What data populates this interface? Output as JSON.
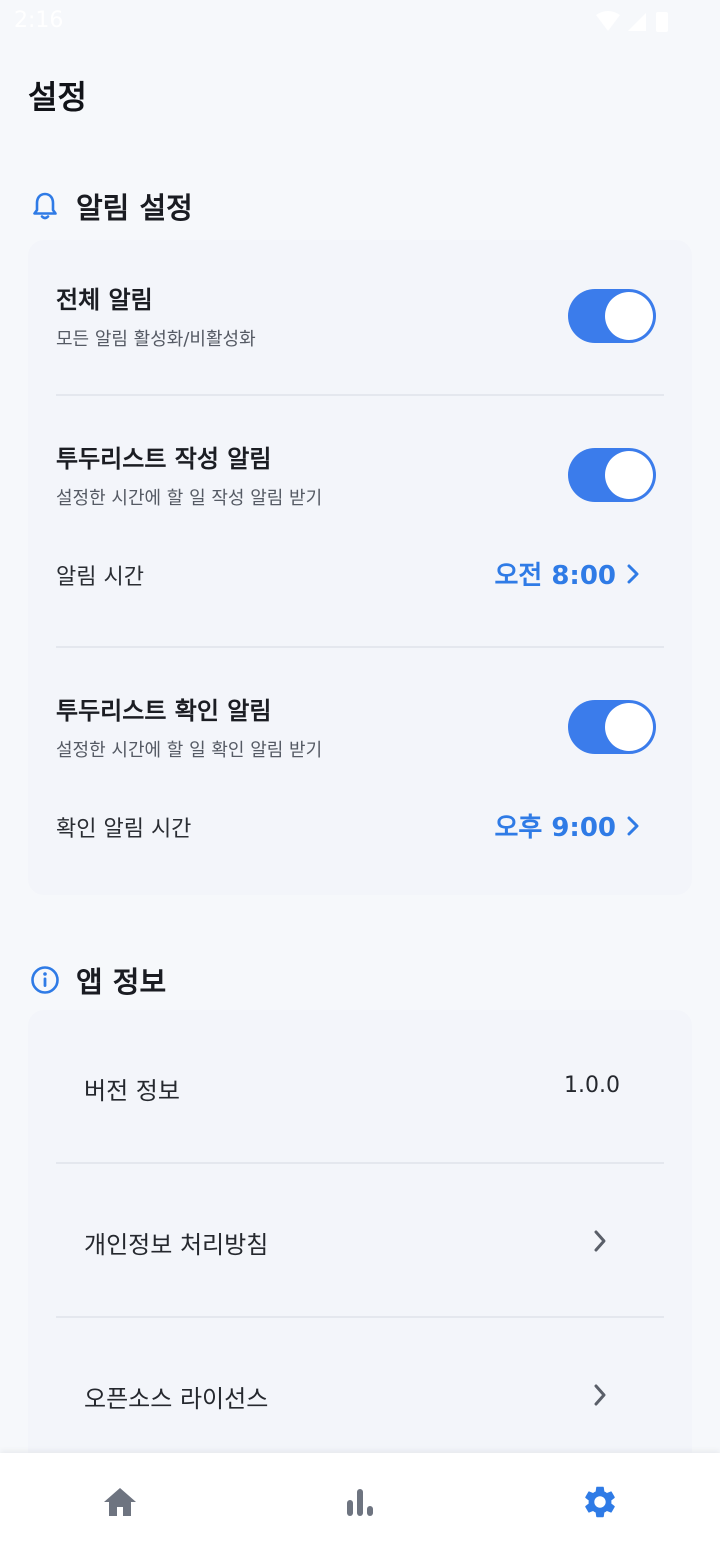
{
  "status_bar": {
    "time": "2:16"
  },
  "page": {
    "title": "설정"
  },
  "notifications": {
    "section_title": "알림 설정",
    "all": {
      "title": "전체 알림",
      "subtitle": "모든 알림 활성화/비활성화",
      "enabled": true
    },
    "todo_write": {
      "title": "투두리스트 작성 알림",
      "subtitle": "설정한 시간에 할 일 작성 알림 받기",
      "enabled": true,
      "time_label": "알림 시간",
      "time_value": "오전 8:00"
    },
    "todo_check": {
      "title": "투두리스트 확인 알림",
      "subtitle": "설정한 시간에 할 일 확인 알림 받기",
      "enabled": true,
      "time_label": "확인 알림 시간",
      "time_value": "오후 9:00"
    }
  },
  "app_info": {
    "section_title": "앱 정보",
    "version": {
      "label": "버전 정보",
      "value": "1.0.0"
    },
    "privacy": {
      "label": "개인정보 처리방침"
    },
    "licenses": {
      "label": "오픈소스 라이선스"
    }
  },
  "bottom_nav": {
    "items": [
      {
        "name": "home",
        "icon": "home-icon",
        "active": false
      },
      {
        "name": "stats",
        "icon": "bar-chart-icon",
        "active": false
      },
      {
        "name": "settings",
        "icon": "gear-icon",
        "active": true
      }
    ]
  },
  "colors": {
    "accent": "#3B7CEB",
    "link": "#2F7BE6",
    "background": "#F6F8FB",
    "inactive_icon": "#6E7480"
  }
}
